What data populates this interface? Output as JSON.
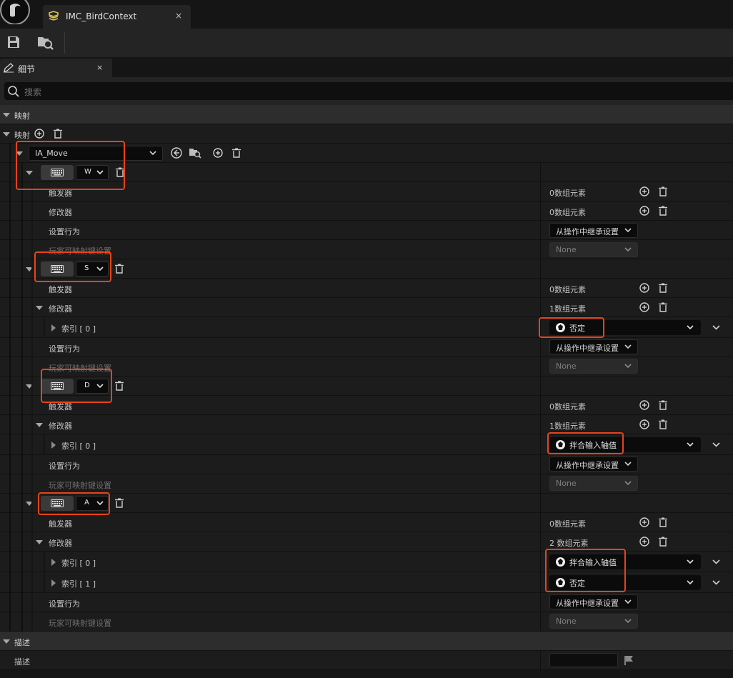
{
  "window": {
    "tab_title": "IMC_BirdContext",
    "tab_close": "×"
  },
  "panel": {
    "tab_label": "细节",
    "tab_close": "×",
    "search_placeholder": "搜索"
  },
  "categories": {
    "mappings": "映射",
    "description": "描述"
  },
  "mappings_array_label": "映射",
  "action": {
    "name": "IA_Move"
  },
  "labels": {
    "triggers": "触发器",
    "modifiers": "修改器",
    "settings_behavior": "设置行为",
    "player_mappable": "玩家可映射键设置",
    "index0": "索引 [ 0 ]",
    "index1": "索引 [ 1 ]"
  },
  "values": {
    "zero_elements": "0数组元素",
    "one_element": "1数组元素",
    "two_elements": "2 数组元素",
    "inherit": "从操作中继承设置",
    "none": "None"
  },
  "keys": {
    "w": "W",
    "s": "S",
    "d": "D",
    "a": "A"
  },
  "modifiers": {
    "negate": "否定",
    "swizzle": "拌合输入轴值"
  },
  "description_label": "描述",
  "colors": {
    "highlight": "#e8431a",
    "background": "#1c1c1c",
    "category": "#2d2d2d"
  }
}
